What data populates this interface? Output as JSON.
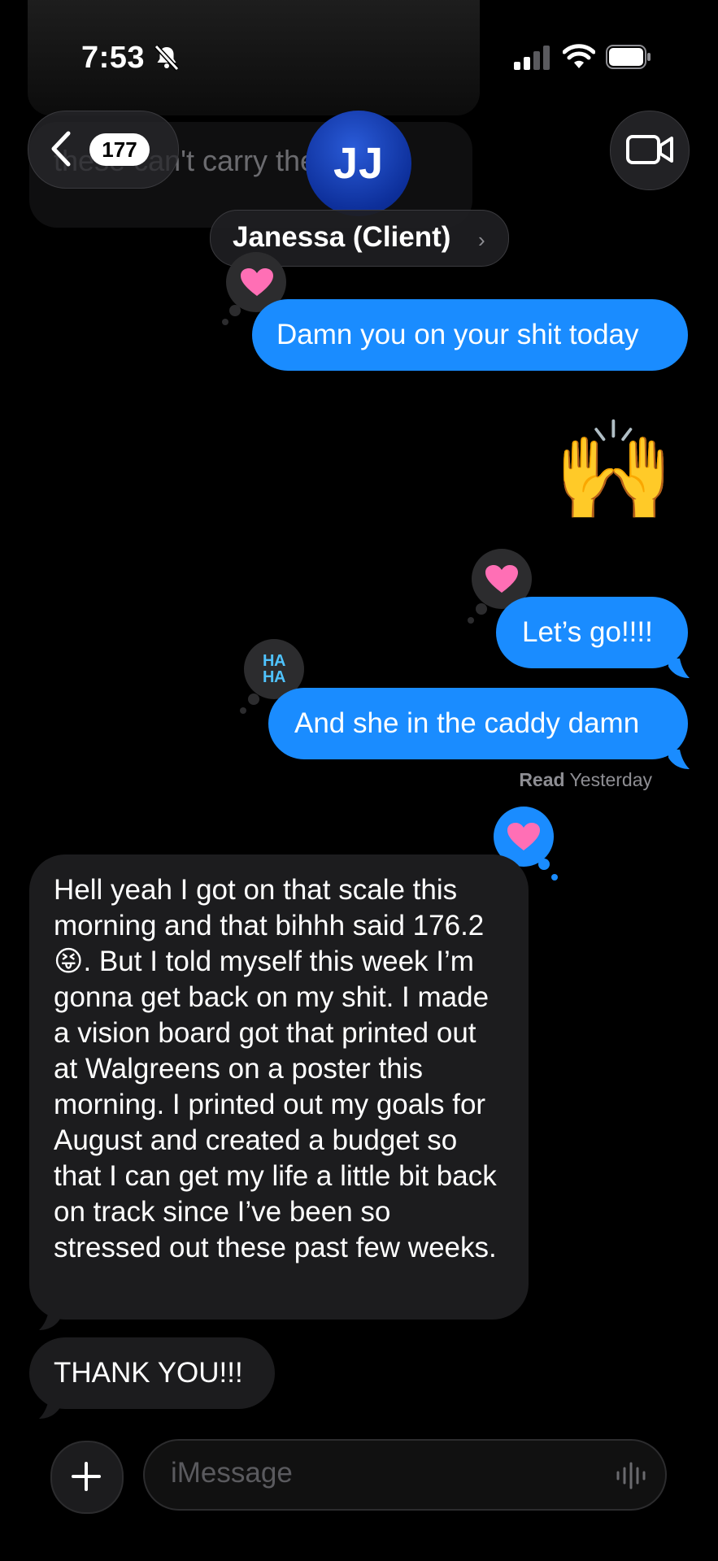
{
  "status_bar": {
    "time": "7:53"
  },
  "ghost_message": {
    "text": "these can't carry them"
  },
  "header": {
    "unread_count": "177",
    "avatar_initials": "JJ",
    "contact_name": "Janessa (Client)",
    "chevron": "›"
  },
  "messages": [
    {
      "direction": "outgoing",
      "text": "Damn you on your shit today",
      "tapback": "heart"
    },
    {
      "direction": "outgoing",
      "text": "🙌",
      "type": "emoji"
    },
    {
      "direction": "outgoing",
      "text": "Let’s go!!!!",
      "tapback": "heart"
    },
    {
      "direction": "outgoing",
      "text": "And she in the caddy damn",
      "tapback": "haha"
    },
    {
      "direction": "incoming",
      "text": "Hell yeah I got on that scale this morning and that bihhh said 176.2 😝.  But I told myself this week I’m gonna get back on my shit. I made a vision board got that printed out at Walgreens on a poster this morning. I printed out my goals for August and created a budget so that I can get my life a little bit back on track since I’ve been so stressed out these past few weeks.",
      "tapback": "heart"
    },
    {
      "direction": "incoming",
      "text": "THANK YOU!!!"
    }
  ],
  "read_receipt": {
    "label": "Read",
    "time": "Yesterday"
  },
  "tapbacks": {
    "haha_text": "HA HA"
  },
  "composer": {
    "placeholder": "iMessage"
  },
  "colors": {
    "outgoing_bubble": "#1a8cff",
    "incoming_bubble": "#1c1c1e",
    "background": "#000000",
    "heart": "#ff6fb5"
  },
  "icons": [
    "bell-slash-icon",
    "signal-icon",
    "wifi-icon",
    "battery-icon",
    "chevron-left-icon",
    "video-camera-icon",
    "heart-icon",
    "haha-icon",
    "plus-icon",
    "waveform-icon"
  ]
}
